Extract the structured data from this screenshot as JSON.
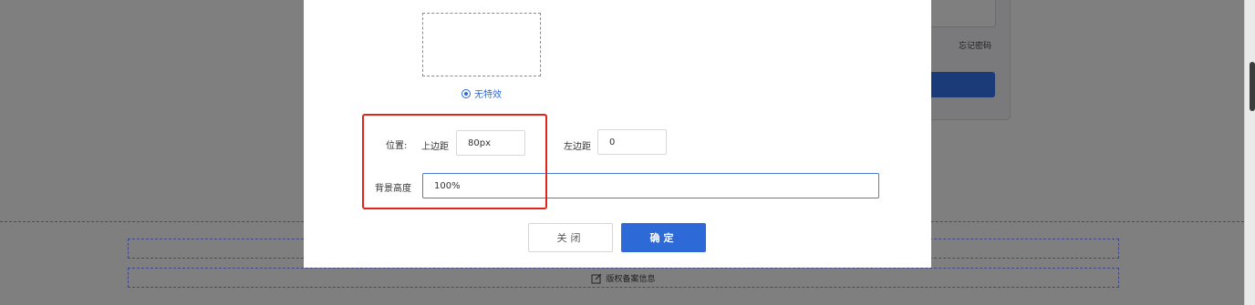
{
  "background": {
    "forgot_password": "忘记密码",
    "footer_copyright": "版权备案信息"
  },
  "dialog": {
    "effect_option": "无特效",
    "position_label": "位置:",
    "top_margin_label": "上边距",
    "top_margin_value": "80px",
    "left_margin_label": "左边距",
    "left_margin_value": "0",
    "bg_height_label": "背景高度",
    "bg_height_value": "100%",
    "close_button": "关闭",
    "confirm_button": "确定"
  },
  "colors": {
    "accent": "#2e69d8",
    "highlight": "#e0251b",
    "overlay": "#7f7f80"
  },
  "icons": {
    "radio": "radio-selected-icon",
    "edit": "edit-icon"
  }
}
